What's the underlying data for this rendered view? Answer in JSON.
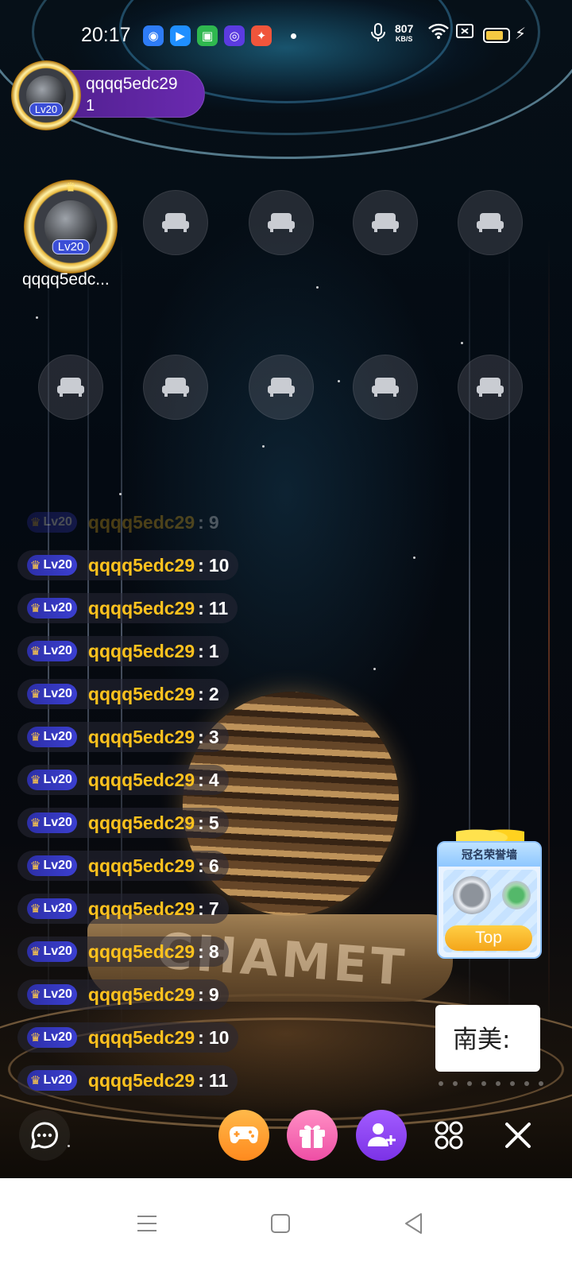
{
  "status_bar": {
    "time": "20:17",
    "network_speed": "807",
    "network_unit": "KB/S",
    "battery_percent": 80,
    "icons": [
      "app-q-icon",
      "app-play-icon",
      "app-green-icon",
      "app-purple-icon",
      "app-game-icon",
      "mic-icon",
      "wifi-icon",
      "sim-icon",
      "battery-icon",
      "charging-icon"
    ]
  },
  "host": {
    "name": "qqqq5edc29",
    "count": "1",
    "avatar_level": "Lv20"
  },
  "seats": {
    "occupant_name": "qqqq5edc...",
    "occupant_level": "Lv20",
    "empty_icon": "sofa-icon"
  },
  "chat": {
    "messages": [
      {
        "level": "Lv20",
        "user": "qqqq5edc29",
        "text": "9"
      },
      {
        "level": "Lv20",
        "user": "qqqq5edc29",
        "text": "10"
      },
      {
        "level": "Lv20",
        "user": "qqqq5edc29",
        "text": "11"
      },
      {
        "level": "Lv20",
        "user": "qqqq5edc29",
        "text": "1"
      },
      {
        "level": "Lv20",
        "user": "qqqq5edc29",
        "text": "2"
      },
      {
        "level": "Lv20",
        "user": "qqqq5edc29",
        "text": "3"
      },
      {
        "level": "Lv20",
        "user": "qqqq5edc29",
        "text": "4"
      },
      {
        "level": "Lv20",
        "user": "qqqq5edc29",
        "text": "5"
      },
      {
        "level": "Lv20",
        "user": "qqqq5edc29",
        "text": "6"
      },
      {
        "level": "Lv20",
        "user": "qqqq5edc29",
        "text": "7"
      },
      {
        "level": "Lv20",
        "user": "qqqq5edc29",
        "text": "8"
      },
      {
        "level": "Lv20",
        "user": "qqqq5edc29",
        "text": "9"
      },
      {
        "level": "Lv20",
        "user": "qqqq5edc29",
        "text": "10"
      },
      {
        "level": "Lv20",
        "user": "qqqq5edc29",
        "text": "11"
      }
    ]
  },
  "backdrop": {
    "brand_text": "CHAMET"
  },
  "honor_wall": {
    "title": "冠名荣誉墙",
    "button": "Top"
  },
  "banner": {
    "text": "南美:"
  },
  "toolbar": {
    "icons": [
      "chat-icon",
      "game-controller-icon",
      "gift-icon",
      "add-user-icon",
      "grid-icon",
      "close-icon"
    ]
  },
  "nav": {
    "icons": [
      "menu-icon",
      "home-icon",
      "back-icon"
    ]
  },
  "colors": {
    "chat_username": "#ffc21e",
    "level_badge": "#3b3fd0",
    "host_pill": "#5b24a0",
    "game_button": "#ff8a1e",
    "gift_button": "#ee4ea5",
    "user_button": "#7b32e6"
  }
}
